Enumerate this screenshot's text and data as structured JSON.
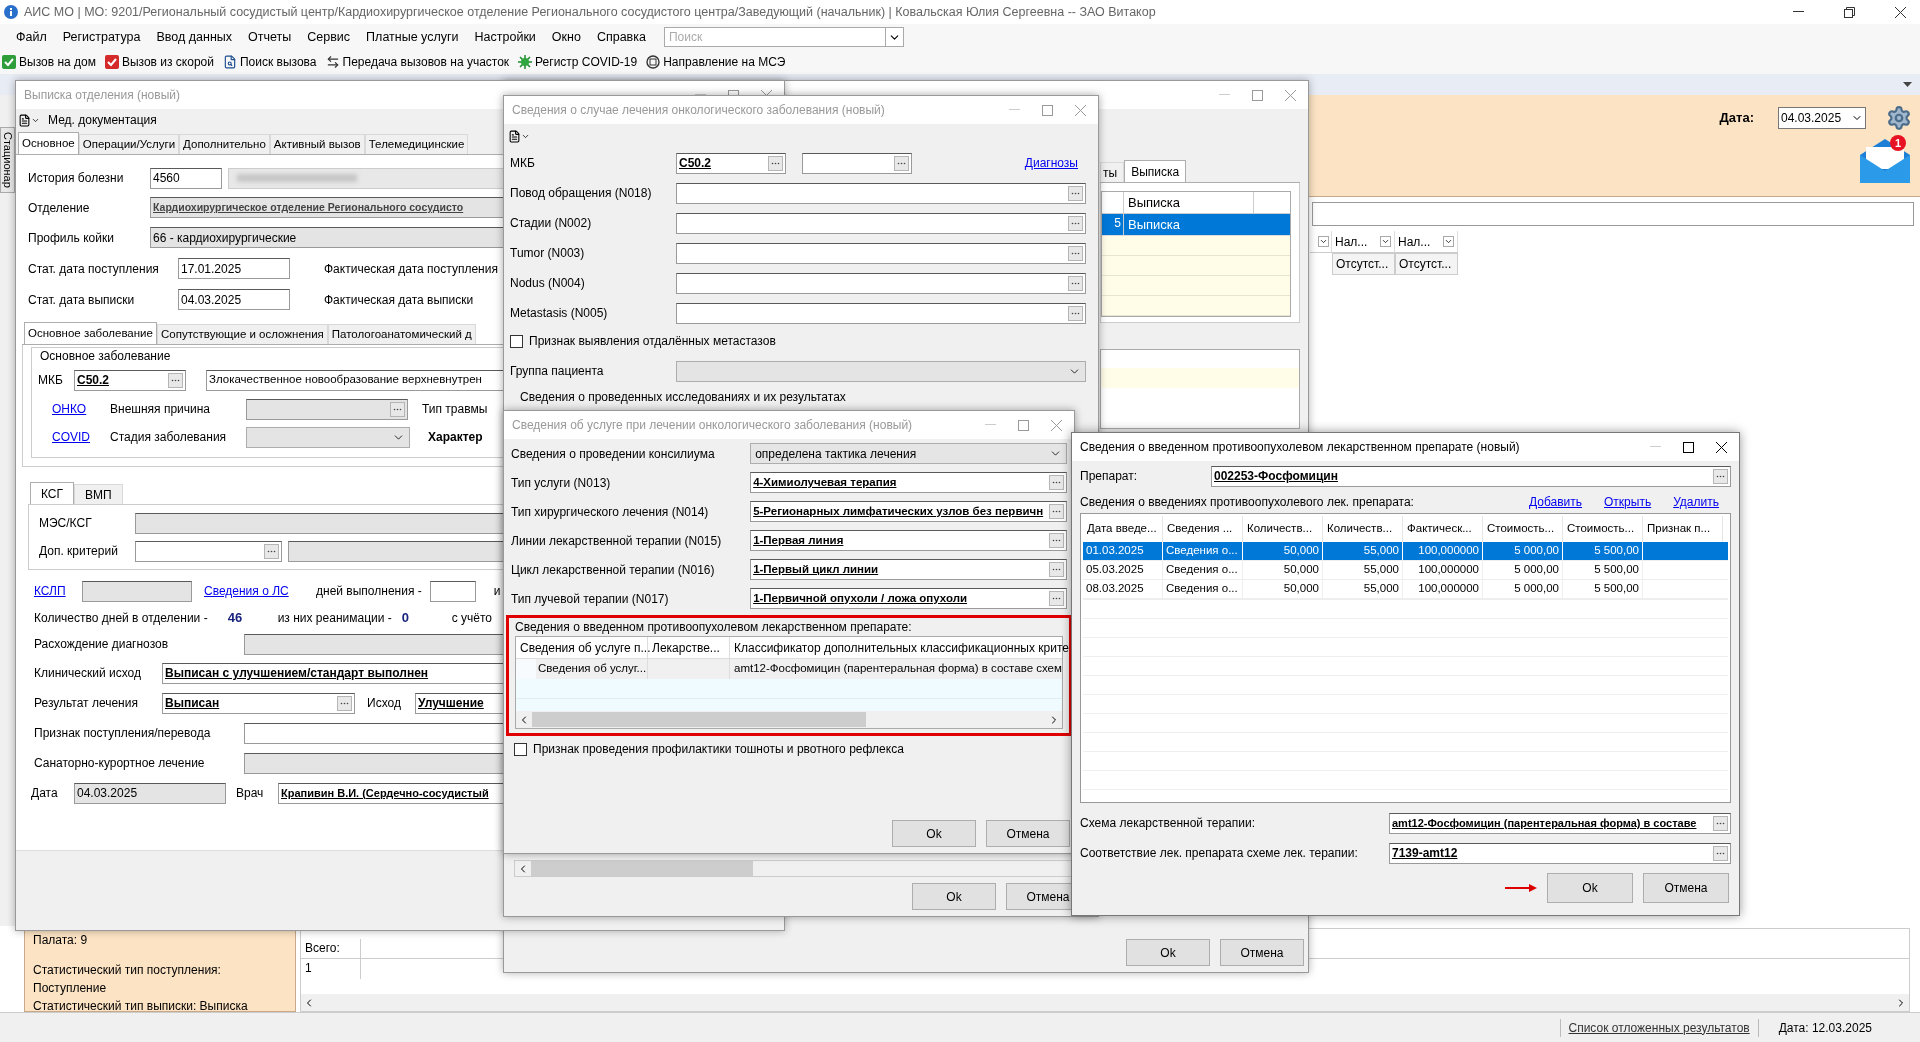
{
  "window": {
    "title": "АИС МО | МО: 9201/Региональный сосудистый центр/Кардиохирургическое отделение Регионального сосудистого центра/Заведующий (начальник) | Ковальская Юлия Сергеевна -- ЗАО Витакор"
  },
  "menu": [
    "Файл",
    "Регистратура",
    "Ввод данных",
    "Отчеты",
    "Сервис",
    "Платные услуги",
    "Настройки",
    "Окно",
    "Справка"
  ],
  "search": {
    "placeholder": "Поиск"
  },
  "toolbar": [
    {
      "kind": "home",
      "label": "Вызов на дом"
    },
    {
      "kind": "ambulance",
      "label": "Вызов из скорой"
    },
    {
      "kind": "search",
      "label": "Поиск вызова"
    },
    {
      "kind": "transfer",
      "label": "Передача вызовов на участок"
    },
    {
      "kind": "covid",
      "label": "Регистр COVID-19"
    },
    {
      "kind": "referral",
      "label": "Направление на МСЭ"
    }
  ],
  "side_tab": "Стационар",
  "header_panel": {
    "date_label": "Дата:",
    "date": "04.03.2025",
    "mail_count": "1"
  },
  "main_grid": {
    "columns": [
      "Нал...",
      "Нал..."
    ],
    "row": [
      "Отсутст...",
      "Отсутст..."
    ]
  },
  "discharge_window": {
    "title": "Выписка отделения (новый)",
    "toolbar_label": "Мед. документация",
    "tabs": [
      {
        "label": "Основное",
        "selected": true
      },
      {
        "label": "Операции/Услуги",
        "selected": false
      },
      {
        "label": "Дополнительно",
        "selected": false
      },
      {
        "label": "Активный вызов",
        "selected": false
      },
      {
        "label": "Телемедицинские",
        "selected": false
      }
    ],
    "history": {
      "label": "История болезни",
      "value": "4560"
    },
    "department": {
      "label": "Отделение",
      "value": "Кардиохирургическое отделение Регионального сосудисто"
    },
    "bed_profile": {
      "label": "Профиль койки",
      "value": "66 - кардиохирургические"
    },
    "admission": {
      "label": "Стат. дата поступления",
      "value": "17.01.2025",
      "actual_label": "Фактическая дата поступления"
    },
    "discharge": {
      "label": "Стат. дата выписки",
      "value": "04.03.2025",
      "actual_label": "Фактическая дата выписки"
    },
    "disease_tabs": [
      {
        "label": "Основное заболевание",
        "selected": true
      },
      {
        "label": "Сопутствующие и осложнения",
        "selected": false
      },
      {
        "label": "Патологоанатомический д",
        "selected": false
      }
    ],
    "disease_group": {
      "title": "Основное заболевание",
      "mkb_label": "МКБ",
      "mkb": "C50.2",
      "diagnosis": "Злокачественное новообразование верхневнутрен",
      "onko_link": "ОНКО",
      "external_cause_label": "Внешняя причина",
      "injury_label": "Тип травмы",
      "covid_link": "COVID",
      "stage_label": "Стадия заболевания",
      "nature_label": "Характер"
    },
    "ksg_tabs": [
      {
        "label": "КСГ",
        "selected": true
      },
      {
        "label": "ВМП",
        "selected": false
      }
    ],
    "mes_label": "МЭС/КСГ",
    "criterion_label": "Доп. критерий",
    "kslp_link": "КСЛП",
    "ls_link": "Сведения о ЛС",
    "days_done_label": "дней выполнения -",
    "days_done_tail": "и",
    "days": {
      "label": "Количество дней в отделении -",
      "value": "46",
      "icu_label": "из них реанимации -",
      "icu_value": "0",
      "tail": "с учёто"
    },
    "divergence_label": "Расхождение диагнозов",
    "clinical_outcome": {
      "label": "Клинический исход",
      "value": "Выписан с улучшением/стандарт выполнен"
    },
    "result": {
      "label": "Результат лечения",
      "value": "Выписан",
      "outcome_label": "Исход",
      "outcome": "Улучшение"
    },
    "transfer_label": "Признак поступления/перевода",
    "sanatorium_label": "Санаторно-курортное лечение",
    "date": {
      "label": "Дата",
      "value": "04.03.2025",
      "doctor_label": "Врач",
      "doctor": "Крапивин В.И. (Сердечно-сосудистый"
    }
  },
  "behind_window": {
    "tabs": [
      {
        "label": "ты",
        "selected": false
      },
      {
        "label": "Выписка",
        "selected": true
      }
    ],
    "column": "Выписка",
    "rows": [
      {
        "cut": "5",
        "value": "Выписка",
        "selected": true
      }
    ],
    "buttons": [
      "Ok",
      "Отмена"
    ]
  },
  "oncology_window": {
    "title": "Сведения о случае лечения онкологического заболевания (новый)",
    "mkb_label": "МКБ",
    "mkb": "C50.2",
    "diagnoses_link": "Диагнозы",
    "fields": [
      "Повод обращения (N018)",
      "Стадии (N002)",
      "Tumor (N003)",
      "Nodus (N004)",
      "Metastasis (N005)"
    ],
    "metastasis_check": {
      "label": "Признак выявления отдалённых метастазов",
      "checked": false
    },
    "group_label": "Группа пациента",
    "studies_title": "Сведения о проведенных исследованиях и их результатах",
    "buttons": [
      "Ok",
      "Отмена"
    ]
  },
  "service_window": {
    "title": "Сведения об услуге при лечении онкологического заболевания (новый)",
    "consilium": {
      "label": "Сведения о проведении консилиума",
      "value": "определена тактика лечения"
    },
    "fields": [
      {
        "label": "Тип услуги (N013)",
        "value": "4-Химиолучевая терапия"
      },
      {
        "label": "Тип хирургического лечения (N014)",
        "value": "5-Регионарных лимфатических узлов без первичн"
      },
      {
        "label": "Линии лекарственной терапии (N015)",
        "value": "1-Первая линия"
      },
      {
        "label": "Цикл лекарственной терапии (N016)",
        "value": "1-Первый цикл линии"
      },
      {
        "label": "Тип лучевой терапии (N017)",
        "value": "1-Первичной опухоли / ложа опухоли"
      }
    ],
    "drug_box": {
      "title": "Сведения о введенном противоопухолевом лекарственном препарате:",
      "columns": [
        "Сведения об услуге п...",
        "Лекарстве...",
        "Классификатор дополнительных классификационных крите"
      ],
      "row": [
        "Сведения об услуг...",
        "amt12-Фосфомицин (парентеральная форма) в составе схем"
      ]
    },
    "nausea_check": {
      "label": "Признак проведения профилактики тошноты и рвотного рефлекса",
      "checked": false
    },
    "buttons": [
      "Ok",
      "Отмена"
    ]
  },
  "drug_window": {
    "title": "Сведения о введенном противоопухолевом лекарственном препарате (новый)",
    "drug_label": "Препарат:",
    "drug": "002253-Фосфомицин",
    "list_title": "Сведения о введениях противоопухолевого лек. препарата:",
    "links": [
      "Добавить",
      "Открыть",
      "Удалить"
    ],
    "columns": [
      "Дата введе...",
      "Сведения ...",
      "Количеств...",
      "Количеств...",
      "Фактическ...",
      "Стоимость...",
      "Стоимость...",
      "Признак п..."
    ],
    "rows": [
      {
        "selected": true,
        "cells": [
          "01.03.2025",
          "Сведения о...",
          "50,000",
          "55,000",
          "100,000000",
          "5 000,00",
          "5 500,00"
        ]
      },
      {
        "selected": false,
        "cells": [
          "05.03.2025",
          "Сведения о...",
          "50,000",
          "55,000",
          "100,000000",
          "5 000,00",
          "5 500,00"
        ]
      },
      {
        "selected": false,
        "cells": [
          "08.03.2025",
          "Сведения о...",
          "50,000",
          "55,000",
          "100,000000",
          "5 000,00",
          "5 500,00"
        ]
      }
    ],
    "scheme": {
      "label": "Схема лекарственной терапии:",
      "value": "amt12-Фосфомицин (парентеральная форма) в составе"
    },
    "match": {
      "label": "Соответствие лек. препарата схеме лек. терапии:",
      "value": "7139-amt12"
    },
    "buttons": [
      "Ok",
      "Отмена"
    ]
  },
  "info_panel": [
    "Палата: 9",
    "Статистический тип поступления:",
    "Поступление",
    "Статистический тип выписки: Выписка"
  ],
  "bottom_grid": {
    "total_label": "Всего:",
    "count": "1"
  },
  "status_bar": {
    "link": "Список отложенных результатов",
    "date": "Дата: 12.03.2025"
  }
}
